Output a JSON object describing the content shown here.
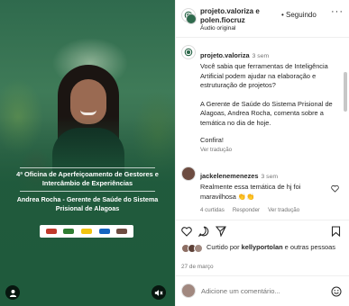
{
  "media": {
    "event_title": "4ª Oficina de Aperfeiçoamento de Gestores e Intercâmbio de Experiências",
    "speaker": "Andrea Rocha - Gerente de Saúde do Sistema Prisional de Alagoas",
    "user_icon": "user-icon",
    "mute_icon": "speaker-muted-icon"
  },
  "header": {
    "authors": "projeto.valoriza e polen.fiocruz",
    "follow_label": "• Seguindo",
    "subtitle": "Áudio original",
    "more_icon": "more-horizontal-icon"
  },
  "caption": {
    "user": "projeto.valoriza",
    "time": "3 sem",
    "text": "Você sabia que ferramentas de Inteligência Artificial podem ajudar na elaboração e estruturação de projetos?",
    "text2": "A Gerente de Saúde do Sistema Prisional de Alagoas, Andrea Rocha, comenta sobre a temática no dia de hoje.",
    "more": "Confira!",
    "translate": "Ver tradução"
  },
  "comment": {
    "user": "jackelenemenezes",
    "time": "3 sem",
    "text": "Realmente essa temática de hj foi maravilhosa 👏👏",
    "likes": "4 curtidas",
    "reply": "Responder",
    "translate": "Ver tradução"
  },
  "liked_by": {
    "text_prefix": "Curtido por ",
    "user": "kellyportolan",
    "text_suffix": " e outras pessoas",
    "date": "27 de março"
  },
  "add_comment": {
    "placeholder": "Adicione um comentário..."
  },
  "colors": {
    "brand_green": "#1f5a3c",
    "text": "#262626",
    "muted": "#737373"
  }
}
